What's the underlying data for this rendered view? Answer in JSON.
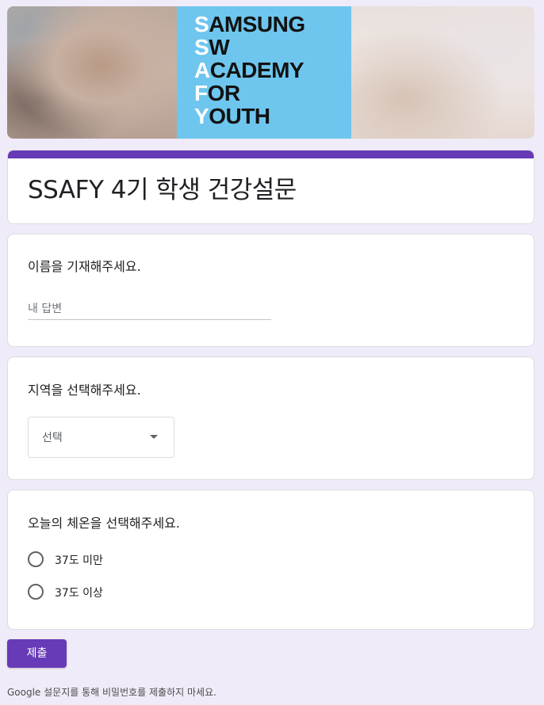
{
  "banner": {
    "logo_lines": [
      {
        "initial": "S",
        "rest": "AMSUNG"
      },
      {
        "initial": "S",
        "rest": "W"
      },
      {
        "initial": "A",
        "rest": "CADEMY"
      },
      {
        "initial": "F",
        "rest": "OR"
      },
      {
        "initial": "Y",
        "rest": "OUTH"
      }
    ],
    "logo_bg_color": "#6ec6ee"
  },
  "form": {
    "title": "SSAFY 4기 학생 건강설문",
    "accent_color": "#673ab7"
  },
  "questions": [
    {
      "label": "이름을 기재해주세요.",
      "type": "short-text",
      "placeholder": "내 답변"
    },
    {
      "label": "지역을 선택해주세요.",
      "type": "dropdown",
      "selected": "선택"
    },
    {
      "label": "오늘의 체온을 선택해주세요.",
      "type": "radio",
      "options": [
        "37도 미만",
        "37도 이상"
      ]
    }
  ],
  "submit_label": "제출",
  "footer_note": "Google 설문지를 통해 비밀번호를 제출하지 마세요.",
  "background_color": "#f0ebf8"
}
